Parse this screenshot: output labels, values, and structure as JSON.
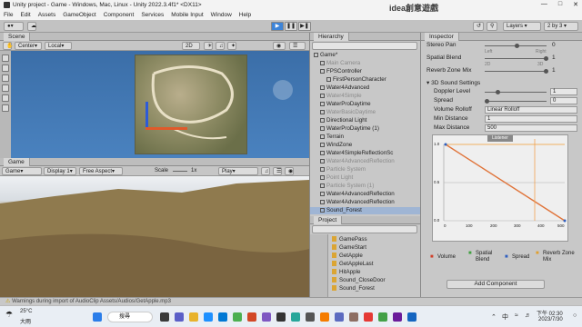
{
  "window": {
    "title": "Unity project - Game - Windows, Mac, Linux - Unity 2022.3.4f1* <DX11>"
  },
  "menu": [
    "File",
    "Edit",
    "Assets",
    "GameObject",
    "Component",
    "Services",
    "Mobile Input",
    "Window",
    "Help"
  ],
  "toolbar": {
    "pivot": "Center",
    "space": "Local",
    "layers": "Layers",
    "layout": "2 by 3"
  },
  "scene": {
    "tab": "Scene",
    "view2d": "2D"
  },
  "game": {
    "tab": "Game",
    "mode": "Game",
    "display": "Display 1",
    "aspect": "Free Aspect",
    "scale_label": "Scale",
    "scale_value": "1x",
    "play_label": "Play"
  },
  "hierarchy": {
    "tab": "Hierarchy",
    "items": [
      {
        "label": "Game*",
        "dim": false,
        "selected": false,
        "indent": 0
      },
      {
        "label": "Main Camera",
        "dim": true,
        "selected": false,
        "indent": 1
      },
      {
        "label": "FPSController",
        "dim": false,
        "selected": false,
        "indent": 1
      },
      {
        "label": "FirstPersonCharacter",
        "dim": false,
        "selected": false,
        "indent": 2
      },
      {
        "label": "Water4Advanced",
        "dim": false,
        "selected": false,
        "indent": 1
      },
      {
        "label": "Water4Simple",
        "dim": true,
        "selected": false,
        "indent": 1
      },
      {
        "label": "WaterProDaytime",
        "dim": false,
        "selected": false,
        "indent": 1
      },
      {
        "label": "WaterBasicDaytime",
        "dim": true,
        "selected": false,
        "indent": 1
      },
      {
        "label": "Directional Light",
        "dim": false,
        "selected": false,
        "indent": 1
      },
      {
        "label": "WaterProDaytime (1)",
        "dim": false,
        "selected": false,
        "indent": 1
      },
      {
        "label": "Terrain",
        "dim": false,
        "selected": false,
        "indent": 1
      },
      {
        "label": "WindZone",
        "dim": false,
        "selected": false,
        "indent": 1
      },
      {
        "label": "Water4SimpleReflectionSc",
        "dim": false,
        "selected": false,
        "indent": 1
      },
      {
        "label": "Water4AdvancedReflection",
        "dim": true,
        "selected": false,
        "indent": 1
      },
      {
        "label": "Particle System",
        "dim": true,
        "selected": false,
        "indent": 1
      },
      {
        "label": "Point Light",
        "dim": true,
        "selected": false,
        "indent": 1
      },
      {
        "label": "Particle System (1)",
        "dim": true,
        "selected": false,
        "indent": 1
      },
      {
        "label": "Water4AdvancedReflection",
        "dim": false,
        "selected": false,
        "indent": 1
      },
      {
        "label": "Water4AdvancedReflection",
        "dim": false,
        "selected": false,
        "indent": 1
      },
      {
        "label": "Sound_Forest",
        "dim": false,
        "selected": true,
        "indent": 1
      }
    ]
  },
  "project": {
    "tab": "Project",
    "items": [
      "GamePass",
      "GameStart",
      "GetApple",
      "GetAppleLast",
      "HitApple",
      "Sound_CloseDoor",
      "Sound_Forest"
    ]
  },
  "inspector": {
    "tab": "Inspector",
    "stereo_pan": {
      "label": "Stereo Pan",
      "value": "0",
      "left": "Left",
      "right": "Right"
    },
    "spatial_blend": {
      "label": "Spatial Blend",
      "value": "1",
      "left": "2D",
      "right": "3D"
    },
    "reverb_zone_mix": {
      "label": "Reverb Zone Mix",
      "value": "1"
    },
    "section_3d": "3D Sound Settings",
    "doppler_level": {
      "label": "Doppler Level",
      "value": "1"
    },
    "spread": {
      "label": "Spread",
      "value": "0"
    },
    "volume_rolloff": {
      "label": "Volume Rolloff",
      "value": "Linear Rolloff"
    },
    "min_distance": {
      "label": "Min Distance",
      "value": "1"
    },
    "max_distance": {
      "label": "Max Distance",
      "value": "500"
    },
    "graph_title": "Listener",
    "graph_ticks": [
      "1.0",
      "0.5",
      "0.0"
    ],
    "graph_xticks": [
      "0",
      "100",
      "200",
      "300",
      "400",
      "500"
    ],
    "legend": [
      "Volume",
      "Spatial Blend",
      "Spread",
      "Reverb Zone Mix"
    ],
    "add_component": "Add Component"
  },
  "statusbar": {
    "text": "Warnings during import of AudioClip Assets/Audios/GetApple.mp3"
  },
  "watermark": "idea創意遊戲",
  "taskbar": {
    "weather_temp": "25°C",
    "weather_desc": "大雨",
    "search": "搜尋",
    "time": "下午 02:30",
    "date": "2023/7/30",
    "lang": "中"
  }
}
